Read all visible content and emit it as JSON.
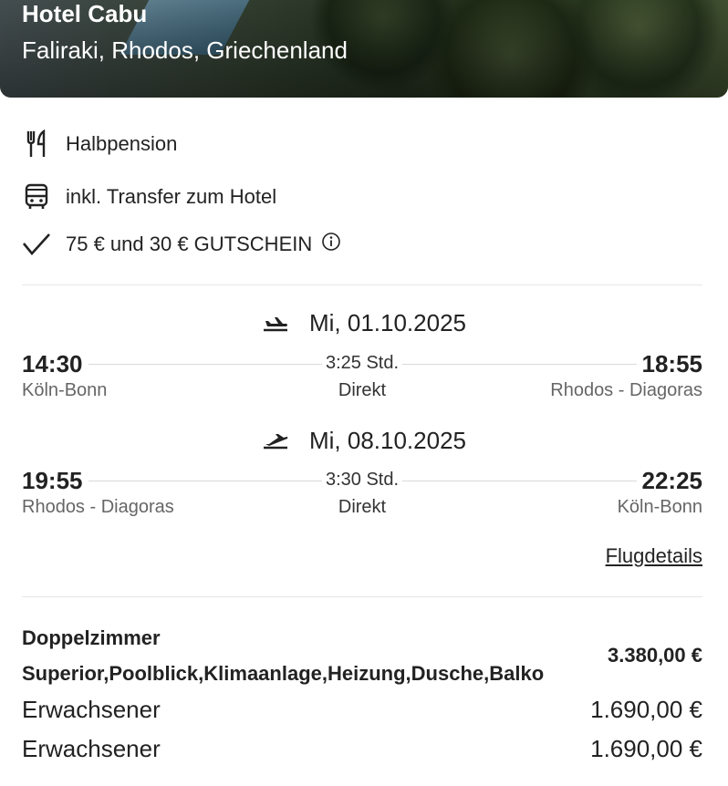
{
  "hotel": {
    "name": "Hotel Cabu",
    "location": "Faliraki, Rhodos, Griechenland"
  },
  "features": [
    {
      "icon": "fork-knife-icon",
      "label": "Halbpension"
    },
    {
      "icon": "bus-icon",
      "label": "inkl. Transfer zum Hotel"
    },
    {
      "icon": "checkmark-icon",
      "label": "75 € und 30 € GUTSCHEIN"
    }
  ],
  "flights": {
    "outbound": {
      "date": "Mi, 01.10.2025",
      "depart_time": "14:30",
      "arrive_time": "18:55",
      "duration": "3:25 Std.",
      "stops": "Direkt",
      "from": "Köln-Bonn",
      "to": "Rhodos - Diagoras"
    },
    "return": {
      "date": "Mi, 08.10.2025",
      "depart_time": "19:55",
      "arrive_time": "22:25",
      "duration": "3:30 Std.",
      "stops": "Direkt",
      "from": "Rhodos - Diagoras",
      "to": "Köln-Bonn"
    },
    "details_link": "Flugdetails"
  },
  "room": {
    "type": "Doppelzimmer",
    "description": "Superior,Poolblick,Klimaanlage,Heizung,Dusche,Balko",
    "price": "3.380,00 €",
    "travellers": [
      {
        "label": "Erwachsener",
        "price": "1.690,00 €"
      },
      {
        "label": "Erwachsener",
        "price": "1.690,00 €"
      }
    ]
  }
}
